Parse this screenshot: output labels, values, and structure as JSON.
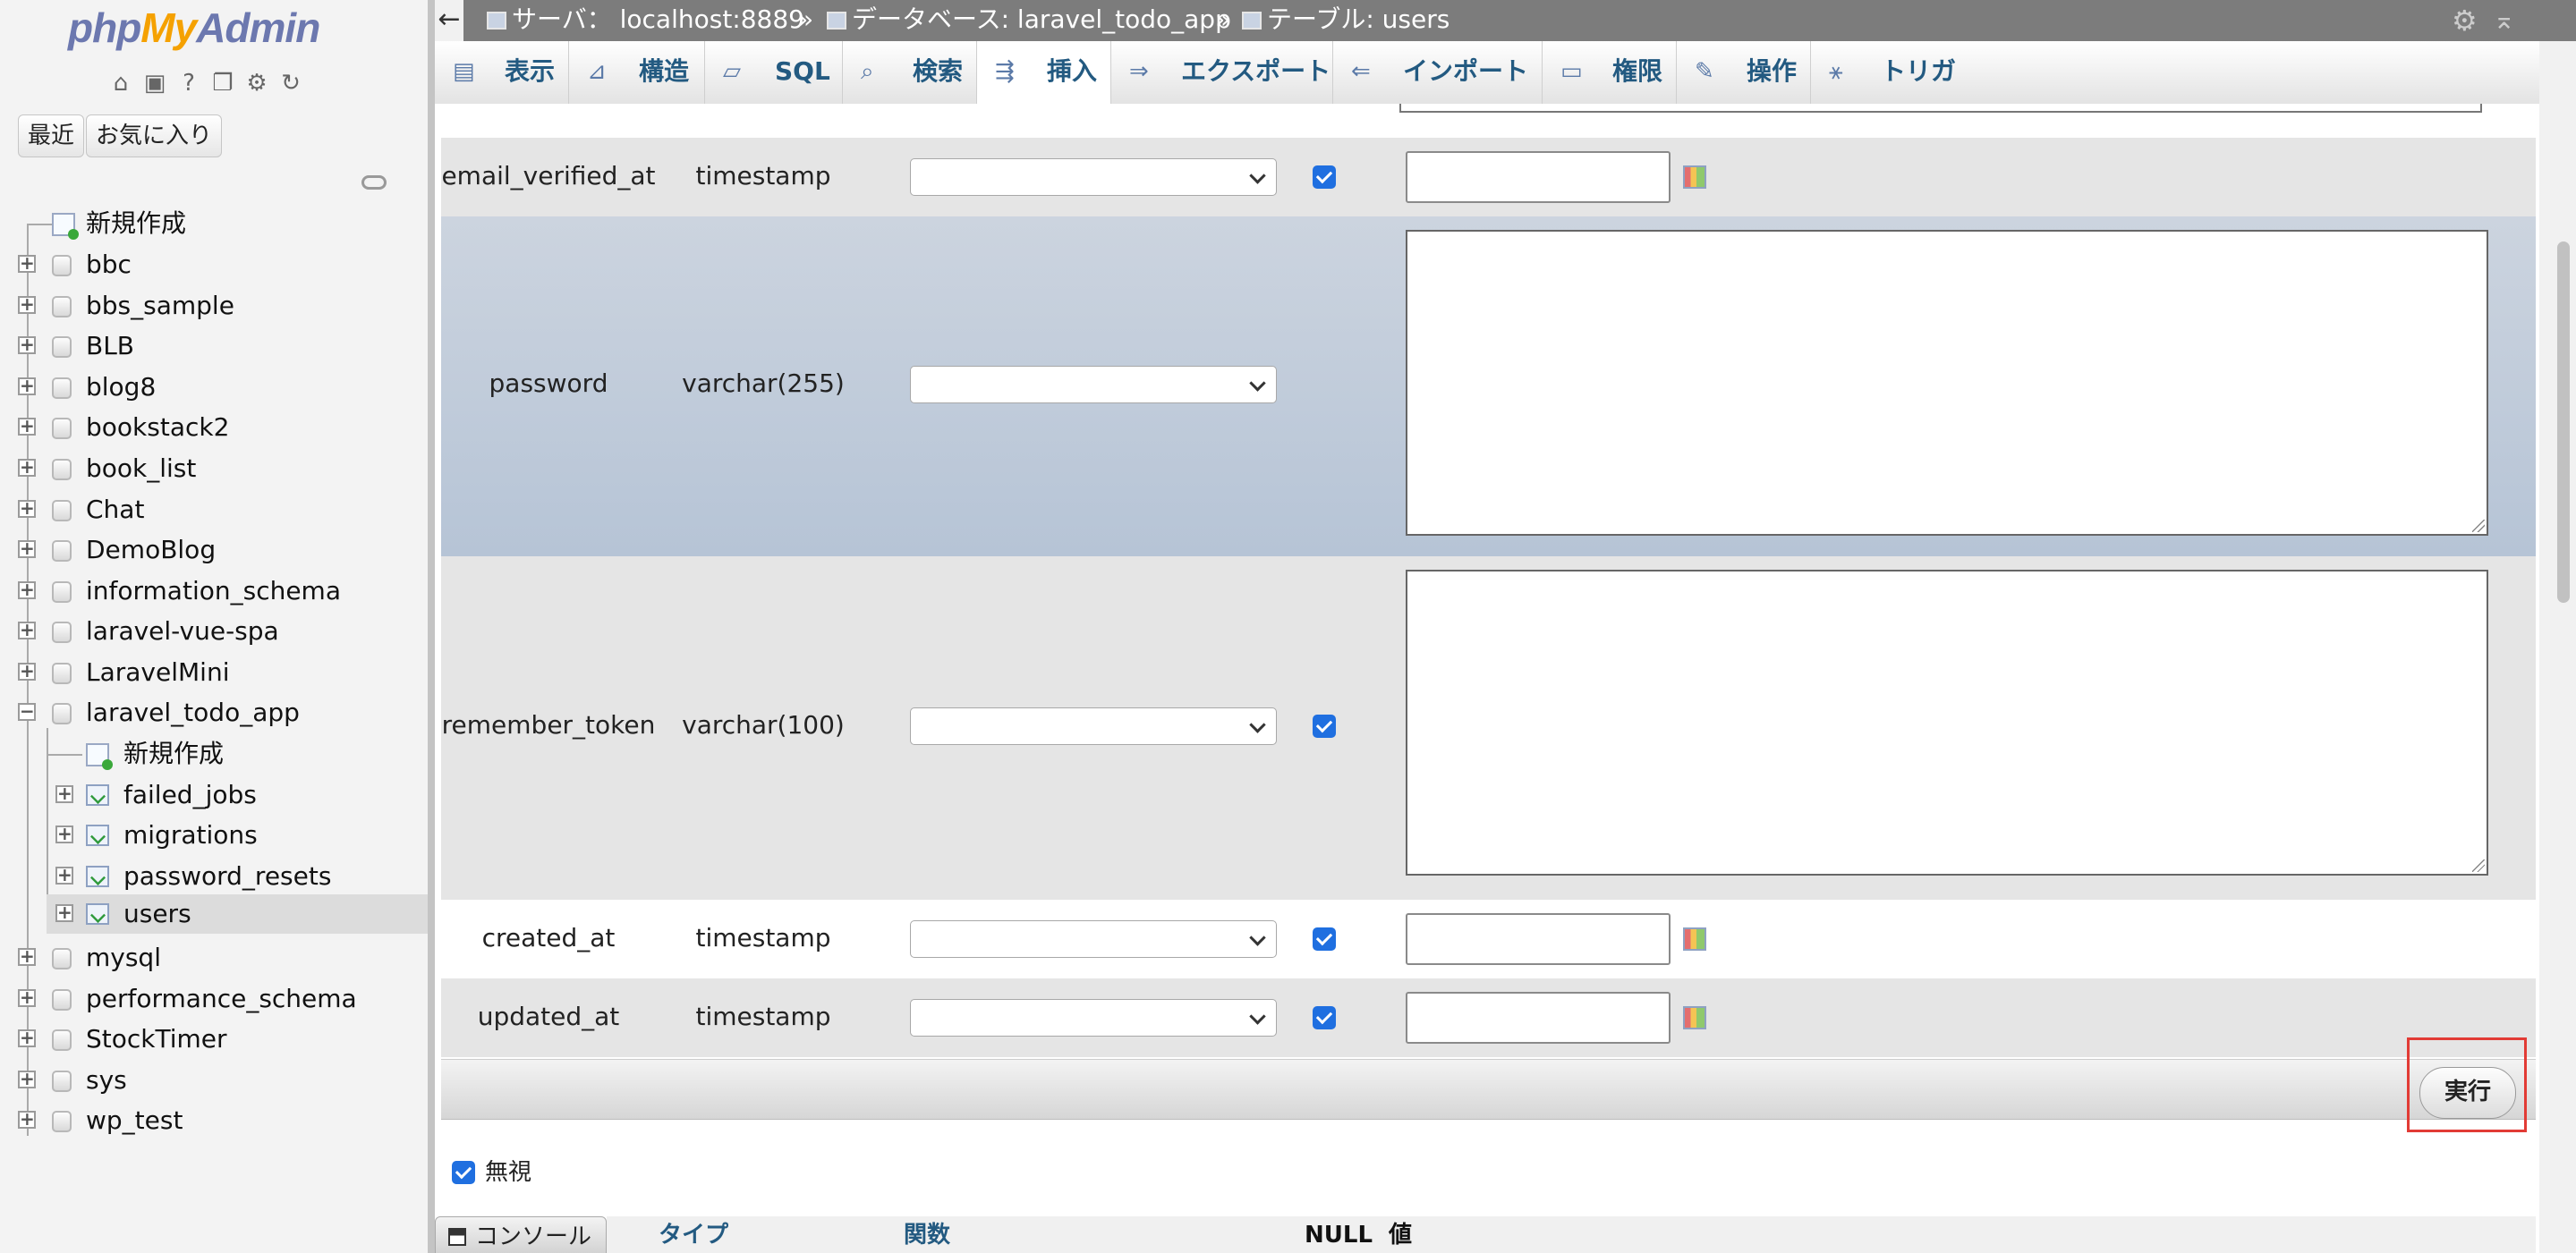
{
  "nav": {
    "logo": {
      "php": "php",
      "my": "My",
      "admin": "Admin"
    },
    "recent_label": "最近",
    "favorites_label": "お気に入り",
    "new_label": "新規作成",
    "databases": [
      {
        "name": "bbc"
      },
      {
        "name": "bbs_sample"
      },
      {
        "name": "BLB"
      },
      {
        "name": "blog8"
      },
      {
        "name": "bookstack2"
      },
      {
        "name": "book_list"
      },
      {
        "name": "Chat"
      },
      {
        "name": "DemoBlog"
      },
      {
        "name": "information_schema"
      },
      {
        "name": "laravel-vue-spa"
      },
      {
        "name": "LaravelMini"
      },
      {
        "name": "laravel_todo_app",
        "expanded": true
      },
      {
        "name": "mysql"
      },
      {
        "name": "performance_schema"
      },
      {
        "name": "StockTimer"
      },
      {
        "name": "sys"
      },
      {
        "name": "wp_test"
      }
    ],
    "laravel_todo_app_children": {
      "new_label": "新規作成",
      "tables": [
        "failed_jobs",
        "migrations",
        "password_resets",
        "users"
      ],
      "selected": "users"
    }
  },
  "breadcrumb": {
    "back": "←",
    "server": "サーバ： localhost:8889",
    "database": "データベース: laravel_todo_app",
    "table": "テーブル: users",
    "separator": "»"
  },
  "tabs": [
    {
      "label": "表示",
      "icon": "browse-icon"
    },
    {
      "label": "構造",
      "icon": "structure-icon"
    },
    {
      "label": "SQL",
      "icon": "sql-icon"
    },
    {
      "label": "検索",
      "icon": "search-icon"
    },
    {
      "label": "挿入",
      "icon": "insert-icon",
      "active": true
    },
    {
      "label": "エクスポート",
      "icon": "export-icon"
    },
    {
      "label": "インポート",
      "icon": "import-icon"
    },
    {
      "label": "権限",
      "icon": "privileges-icon"
    },
    {
      "label": "操作",
      "icon": "operations-icon"
    },
    {
      "label": "トリガ",
      "icon": "triggers-icon"
    }
  ],
  "form": {
    "rows": [
      {
        "column": "email_verified_at",
        "type": "timestamp",
        "function": "",
        "null_checked": true,
        "value": ""
      },
      {
        "column": "password",
        "type": "varchar(255)",
        "function": "",
        "null_checked": false,
        "value": ""
      },
      {
        "column": "remember_token",
        "type": "varchar(100)",
        "function": "",
        "null_checked": true,
        "value": ""
      },
      {
        "column": "created_at",
        "type": "timestamp",
        "function": "",
        "null_checked": true,
        "value": ""
      },
      {
        "column": "updated_at",
        "type": "timestamp",
        "function": "",
        "null_checked": true,
        "value": ""
      }
    ],
    "execute_label": "実行",
    "ignore_label": "無視",
    "ignore_checked": true
  },
  "console": {
    "label": "コンソール"
  },
  "second_form_headers": {
    "type": "タイプ",
    "function": "関数",
    "null": "NULL",
    "value": "値"
  },
  "colors": {
    "highlight": "#e23b35",
    "checkbox": "#1f6fe0",
    "link": "#235a81"
  }
}
